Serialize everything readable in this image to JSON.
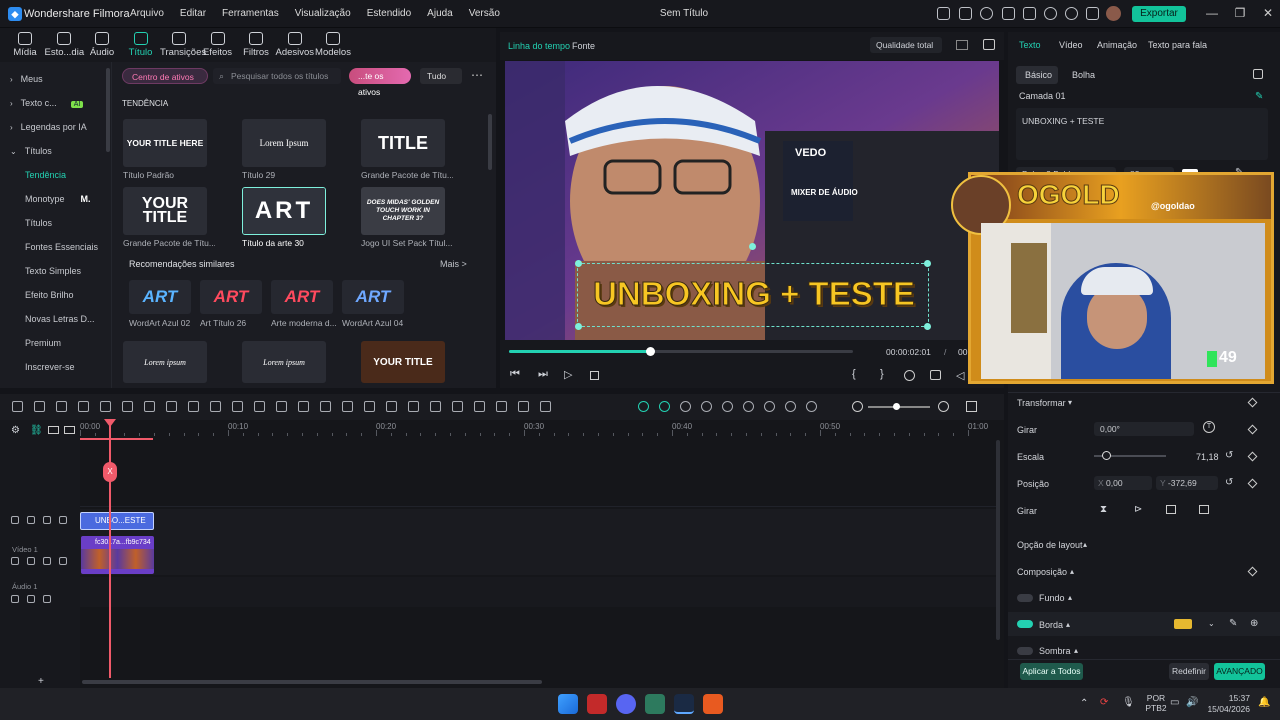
{
  "app": {
    "name": "Wondershare Filmora",
    "doc_title": "Sem Título",
    "export_label": "Exportar"
  },
  "menu": [
    "Arquivo",
    "Editar",
    "Ferramentas",
    "Visualização",
    "Estendido",
    "Ajuda",
    "Versão"
  ],
  "media_tabs": [
    {
      "label": "Mídia",
      "icon": "media-icon"
    },
    {
      "label": "Esto...dia",
      "icon": "stock-media-icon"
    },
    {
      "label": "Áudio",
      "icon": "audio-icon"
    },
    {
      "label": "Título",
      "icon": "title-icon",
      "active": true
    },
    {
      "label": "Transições",
      "icon": "transitions-icon"
    },
    {
      "label": "Efeitos",
      "icon": "effects-icon"
    },
    {
      "label": "Filtros",
      "icon": "filters-icon"
    },
    {
      "label": "Adesivos",
      "icon": "stickers-icon"
    },
    {
      "label": "Modelos",
      "icon": "templates-icon"
    }
  ],
  "sidebar": [
    {
      "label": "Meus",
      "arrow": "›"
    },
    {
      "label": "Texto c...",
      "arrow": "›",
      "badge": "AI"
    },
    {
      "label": "Legendas por IA",
      "arrow": "›"
    },
    {
      "label": "Títulos",
      "arrow": "⌄"
    },
    {
      "label": "Tendência",
      "selected": true
    },
    {
      "label": "Monotype",
      "badge": "M."
    },
    {
      "label": "Títulos"
    },
    {
      "label": "Fontes Essenciais"
    },
    {
      "label": "Texto Simples"
    },
    {
      "label": "Efeito Brilho"
    },
    {
      "label": "Novas Letras D..."
    },
    {
      "label": "Premium"
    },
    {
      "label": "Inscrever-se"
    }
  ],
  "browser": {
    "centro_label": "Centro de ativos",
    "search_placeholder": "Pesquisar todos os títulos",
    "market_label": "...te os ativos",
    "filter_label": "Tudo",
    "section_title": "TENDÊNCIA",
    "cards": [
      {
        "label": "Título Padrão",
        "preview": "YOUR TITLE HERE"
      },
      {
        "label": "Título 29",
        "preview": "Lorem Ipsum"
      },
      {
        "label": "Grande Pacote de Títu...",
        "preview": "TITLE"
      },
      {
        "label": "Grande Pacote de Títu...",
        "preview": "YOUR TITLE"
      },
      {
        "label": "Título da arte 30",
        "preview": "ART"
      },
      {
        "label": "Jogo UI Set Pack Títul...",
        "preview": "DOES MIDAS' GOLDEN TOUCH WORK IN CHAPTER 3?"
      }
    ],
    "similar_title": "Recomendações similares",
    "more_label": "Mais >",
    "similar": [
      {
        "label": "WordArt Azul 02",
        "preview": "ART",
        "color": "#5ab4ff"
      },
      {
        "label": "Art Título 26",
        "preview": "ART",
        "color": "#ff4a5e"
      },
      {
        "label": "Arte moderna d...",
        "preview": "ART",
        "color": "#ff4a5e"
      },
      {
        "label": "WordArt Azul 04",
        "preview": "ART",
        "color": "#6fa8ff"
      }
    ],
    "bottom_cards": [
      {
        "preview": "Lorem ipsum"
      },
      {
        "preview": "Lorem ipsum"
      },
      {
        "preview": "YOUR TITLE"
      }
    ]
  },
  "preview": {
    "tab_timeline": "Linha do tempo",
    "tab_source": "Fonte",
    "quality": "Qualidade total",
    "overlay_text": "UNBOXING + TESTE",
    "time_current": "00:00:02:01",
    "time_sep": "/",
    "time_total": "00",
    "progress": 0.41,
    "device_brand": "VEDO",
    "device_text": "MIXER DE ÁUDIO"
  },
  "right": {
    "tabs": [
      "Texto",
      "Vídeo",
      "Animação",
      "Texto para fala"
    ],
    "subtabs": [
      "Básico",
      "Bolha"
    ],
    "layer": "Camada 01",
    "text_value": "UNBOXING + TESTE",
    "font": "Baloo 2 Bold",
    "font_size": "83",
    "transform_label": "Transformar",
    "rotate_label": "Girar",
    "rotate_value": "0,00°",
    "scale_label": "Escala",
    "scale_value": "71,18",
    "position_label": "Posição",
    "pos_x_label": "X",
    "pos_x": "0,00",
    "pos_y_label": "Y",
    "pos_y": "-372,69",
    "flip_label": "Girar",
    "layout_label": "Opção de layout",
    "composition_label": "Composição",
    "fundo_label": "Fundo",
    "borda_label": "Borda",
    "sombra_label": "Sombra",
    "apply_all": "Aplicar a Todos",
    "reset": "Redefinir",
    "advanced": "AVANÇADO",
    "border_color": "#e6b830"
  },
  "overlay": {
    "brand": "OGOLD",
    "handle": "@ogoldao",
    "counter": "49"
  },
  "timeline": {
    "ruler": [
      "00:00",
      "00:10",
      "00:20",
      "00:30",
      "00:40",
      "00:50",
      "01:00"
    ],
    "track_video": "Vídeo 1",
    "track_audio": "Áudio 1",
    "title_clip": "UNBO...ESTE",
    "video_clip": "fc3017a...fb9c734",
    "playhead_marker": "X"
  },
  "taskbar": {
    "lang": "POR",
    "lang2": "PTB2",
    "time": "15:37",
    "date": "15/04/2026"
  }
}
